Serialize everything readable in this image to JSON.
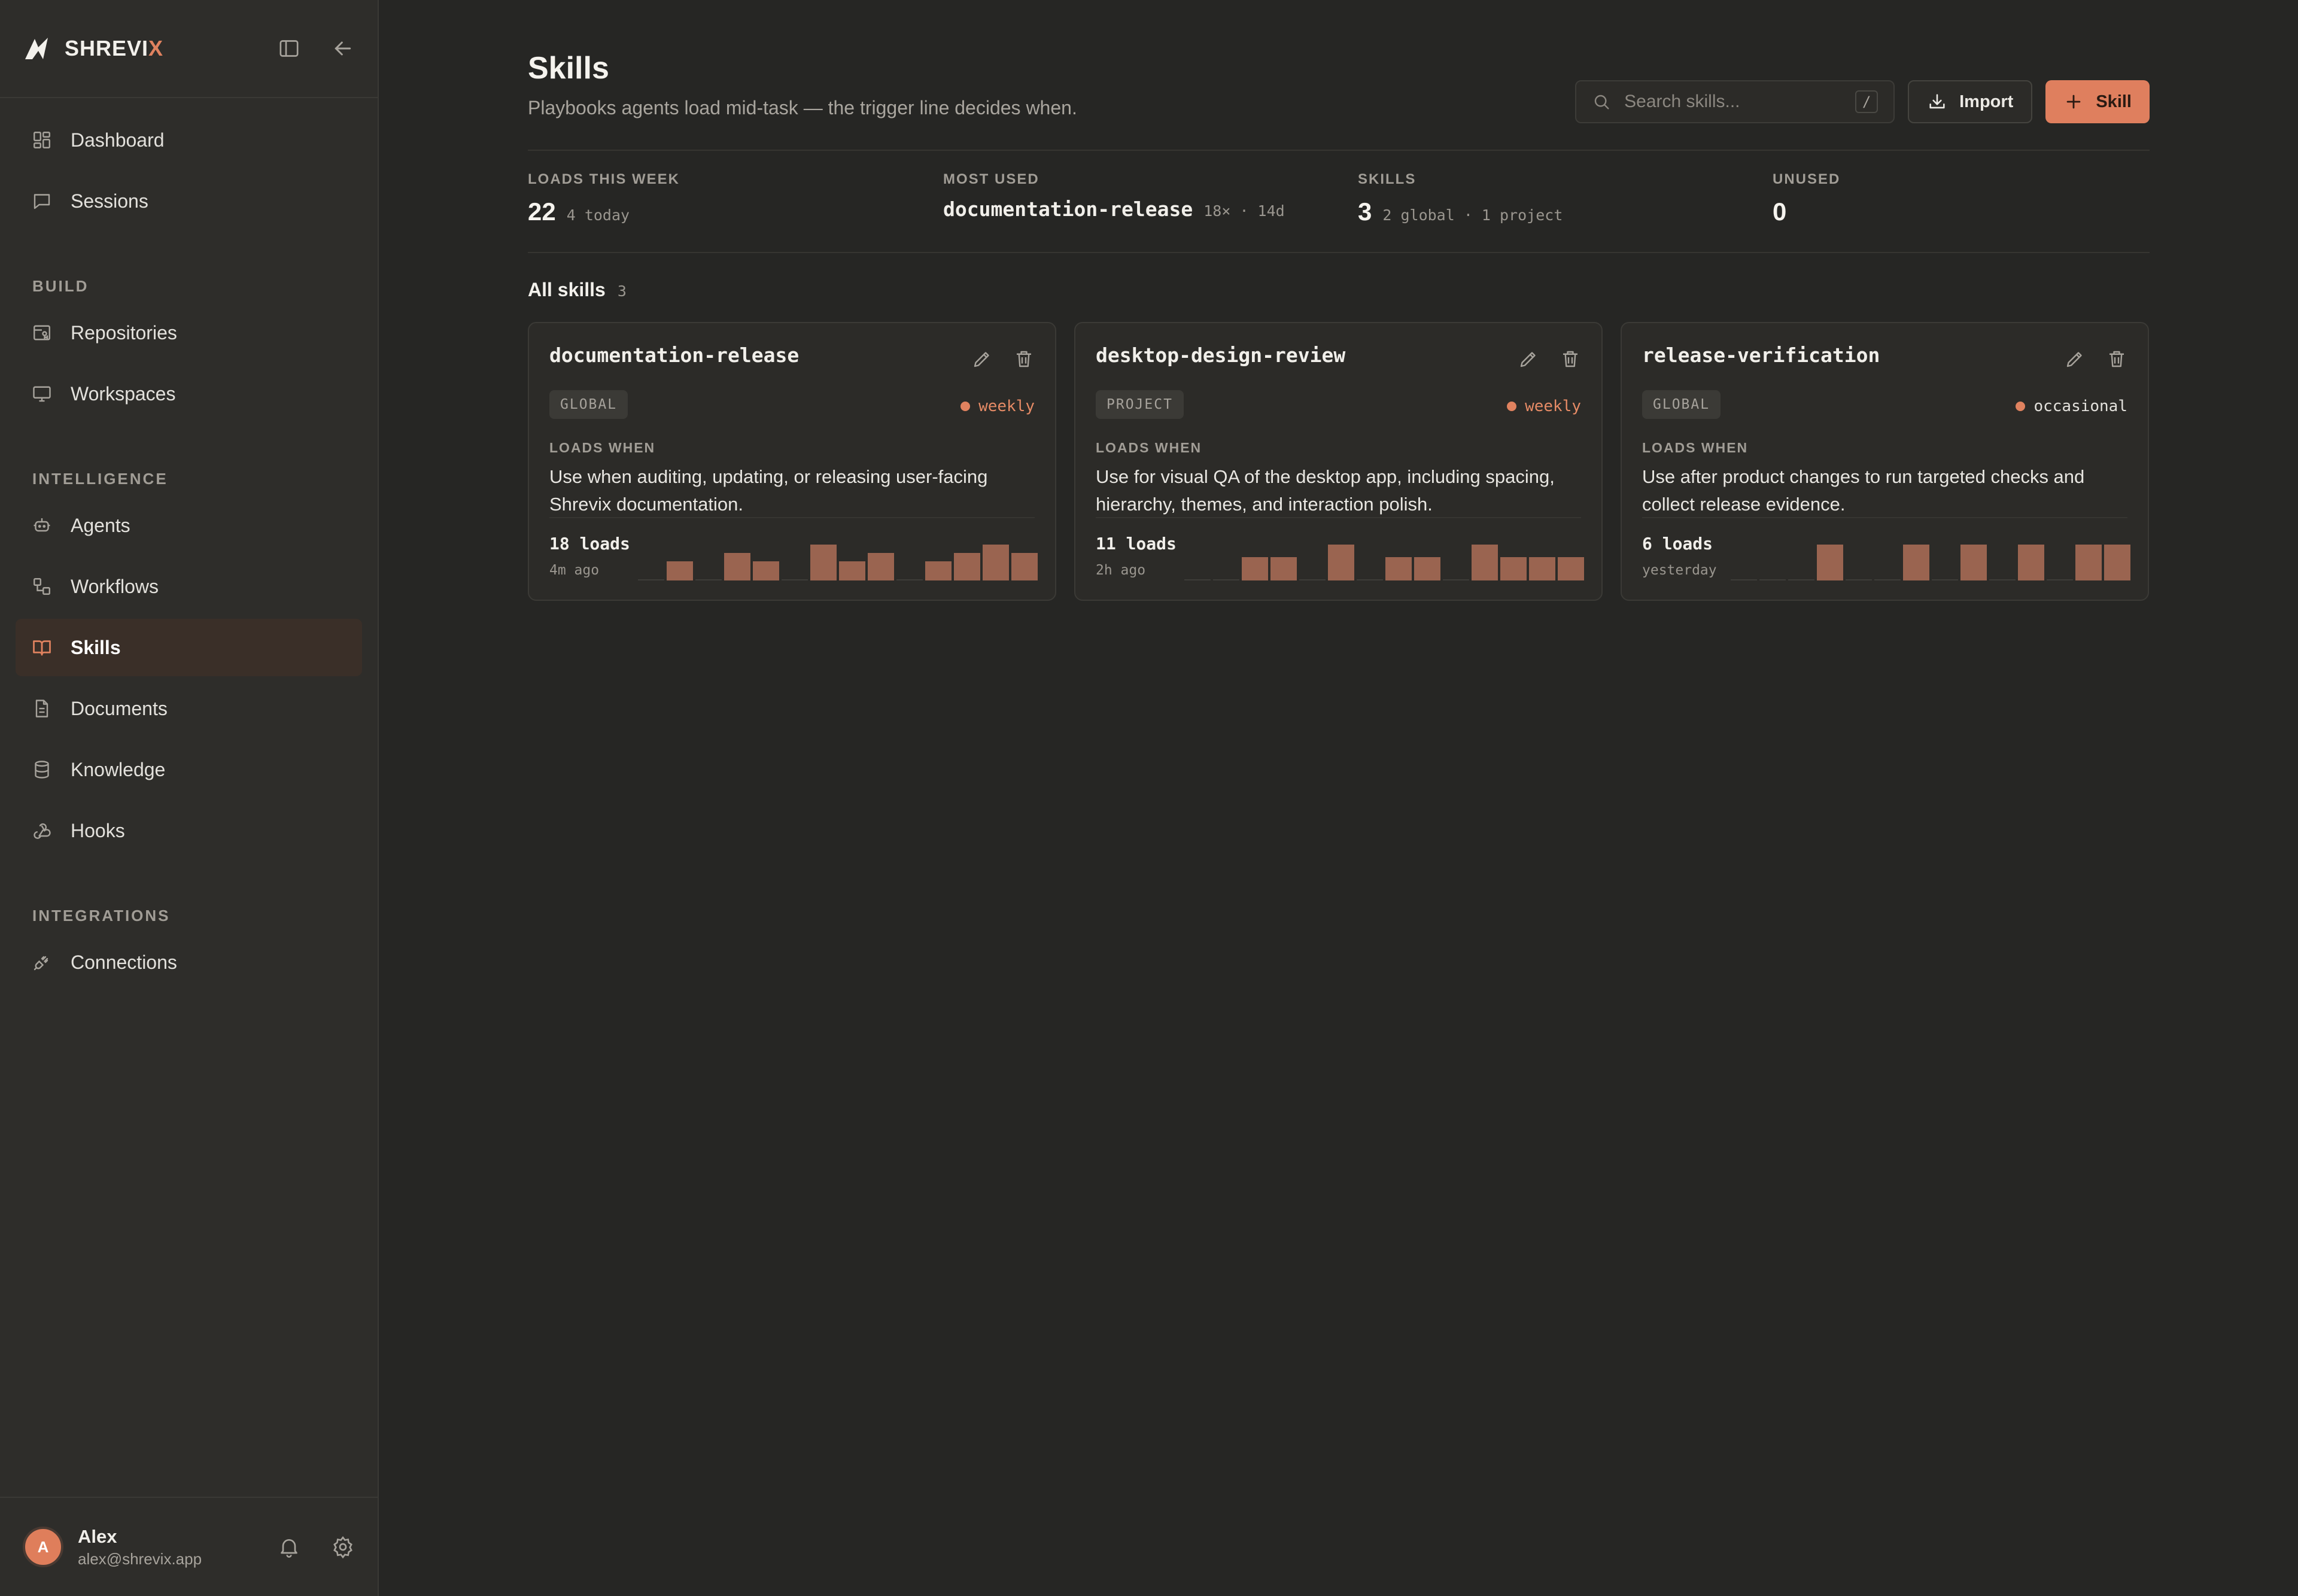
{
  "app": {
    "brand_main": "SHREVI",
    "brand_accent": "X",
    "accent_color": "#e0825f"
  },
  "sidebar": {
    "top_items": [
      {
        "label": "Dashboard",
        "icon": "grid-icon"
      },
      {
        "label": "Sessions",
        "icon": "chat-icon"
      }
    ],
    "sections": [
      {
        "title": "BUILD",
        "items": [
          {
            "label": "Repositories",
            "icon": "repo-icon"
          },
          {
            "label": "Workspaces",
            "icon": "monitor-icon"
          }
        ]
      },
      {
        "title": "INTELLIGENCE",
        "items": [
          {
            "label": "Agents",
            "icon": "robot-icon"
          },
          {
            "label": "Workflows",
            "icon": "workflow-icon"
          },
          {
            "label": "Skills",
            "icon": "book-icon",
            "active": true
          },
          {
            "label": "Documents",
            "icon": "document-icon"
          },
          {
            "label": "Knowledge",
            "icon": "database-icon"
          },
          {
            "label": "Hooks",
            "icon": "webhook-icon"
          }
        ]
      },
      {
        "title": "INTEGRATIONS",
        "items": [
          {
            "label": "Connections",
            "icon": "plug-icon"
          }
        ]
      }
    ],
    "user": {
      "initial": "A",
      "name": "Alex",
      "email": "alex@shrevix.app"
    }
  },
  "header": {
    "title": "Skills",
    "subtitle": "Playbooks agents load mid-task — the trigger line decides when.",
    "search_placeholder": "Search skills...",
    "search_shortcut": "/",
    "import_label": "Import",
    "add_label": "Skill"
  },
  "stats": {
    "loads_week": {
      "label": "LOADS THIS WEEK",
      "value": "22",
      "detail": "4 today"
    },
    "most_used": {
      "label": "MOST USED",
      "value": "documentation-release",
      "detail": "18× · 14d"
    },
    "skills": {
      "label": "SKILLS",
      "value": "3",
      "detail": "2 global · 1 project"
    },
    "unused": {
      "label": "UNUSED",
      "value": "0"
    }
  },
  "section": {
    "title": "All skills",
    "count": "3"
  },
  "loads_when_label": "LOADS WHEN",
  "skills": [
    {
      "name": "documentation-release",
      "scope": "GLOBAL",
      "frequency": "weekly",
      "frequency_style": "accent",
      "loads_when": "Use when auditing, updating, or releasing user-facing Shrevix documentation.",
      "loads": "18 loads",
      "last": "4m ago",
      "activity": [
        0,
        1,
        0,
        2,
        1,
        0,
        3,
        1,
        2,
        0,
        1,
        2,
        3,
        2
      ]
    },
    {
      "name": "desktop-design-review",
      "scope": "PROJECT",
      "frequency": "weekly",
      "frequency_style": "accent",
      "loads_when": "Use for visual QA of the desktop app, including spacing, hierarchy, themes, and interaction polish.",
      "loads": "11 loads",
      "last": "2h ago",
      "activity": [
        0,
        0,
        1,
        1,
        0,
        2,
        0,
        1,
        1,
        0,
        2,
        1,
        1,
        1
      ]
    },
    {
      "name": "release-verification",
      "scope": "GLOBAL",
      "frequency": "occasional",
      "frequency_style": "plain",
      "loads_when": "Use after product changes to run targeted checks and collect release evidence.",
      "loads": "6 loads",
      "last": "yesterday",
      "activity": [
        0,
        0,
        0,
        1,
        0,
        0,
        1,
        0,
        1,
        0,
        1,
        0,
        1,
        1
      ]
    }
  ]
}
